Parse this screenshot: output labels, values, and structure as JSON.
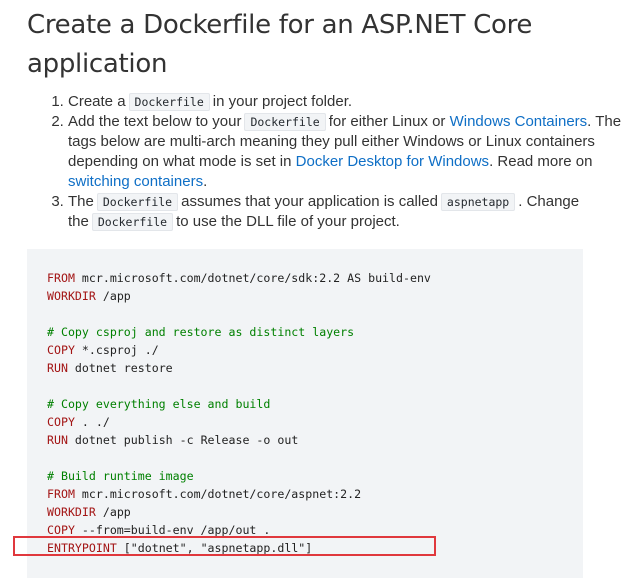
{
  "page": {
    "title": "Create a Dockerfile for an ASP.NET Core application"
  },
  "steps": {
    "s1": {
      "pre": "Create a",
      "code": "Dockerfile",
      "post": "in your project folder."
    },
    "s2": {
      "pre": "Add the text below to your",
      "code": "Dockerfile",
      "mid": "for either Linux or",
      "link1": "Windows Containers",
      "mid2": ". The tags below are multi-arch meaning they pull either Windows or Linux containers depending on what mode is set in",
      "link2": "Docker Desktop for Windows",
      "mid3": ". Read more on",
      "link3": "switching containers",
      "post": "."
    },
    "s3": {
      "pre": "The",
      "code1": "Dockerfile",
      "mid": "assumes that your application is called",
      "code2": "aspnetapp",
      "mid2": ". Change the",
      "code3": "Dockerfile",
      "post": "to use the DLL file of your project."
    }
  },
  "code": {
    "l1": {
      "kw": "FROM",
      "rest": " mcr.microsoft.com/dotnet/core/sdk:2.2 AS build-env"
    },
    "l2": {
      "kw": "WORKDIR",
      "rest": " /app"
    },
    "l4": "# Copy csproj and restore as distinct layers",
    "l5": {
      "kw": "COPY",
      "rest": " *.csproj ./"
    },
    "l6": {
      "kw": "RUN",
      "rest": " dotnet restore"
    },
    "l8": "# Copy everything else and build",
    "l9": {
      "kw": "COPY",
      "rest": " . ./"
    },
    "l10": {
      "kw": "RUN",
      "rest": " dotnet publish -c Release -o out"
    },
    "l12": "# Build runtime image",
    "l13": {
      "kw": "FROM",
      "rest": " mcr.microsoft.com/dotnet/core/aspnet:2.2"
    },
    "l14": {
      "kw": "WORKDIR",
      "rest": " /app"
    },
    "l15": {
      "kw": "COPY",
      "rest": " --from=build-env /app/out ."
    },
    "l16": {
      "kw": "ENTRYPOINT",
      "rest": " [\"dotnet\", \"aspnetapp.dll\"]"
    }
  },
  "colors": {
    "link": "#0f6fc6",
    "highlight_border": "#e0383d",
    "code_bg": "#f2f4f6"
  }
}
